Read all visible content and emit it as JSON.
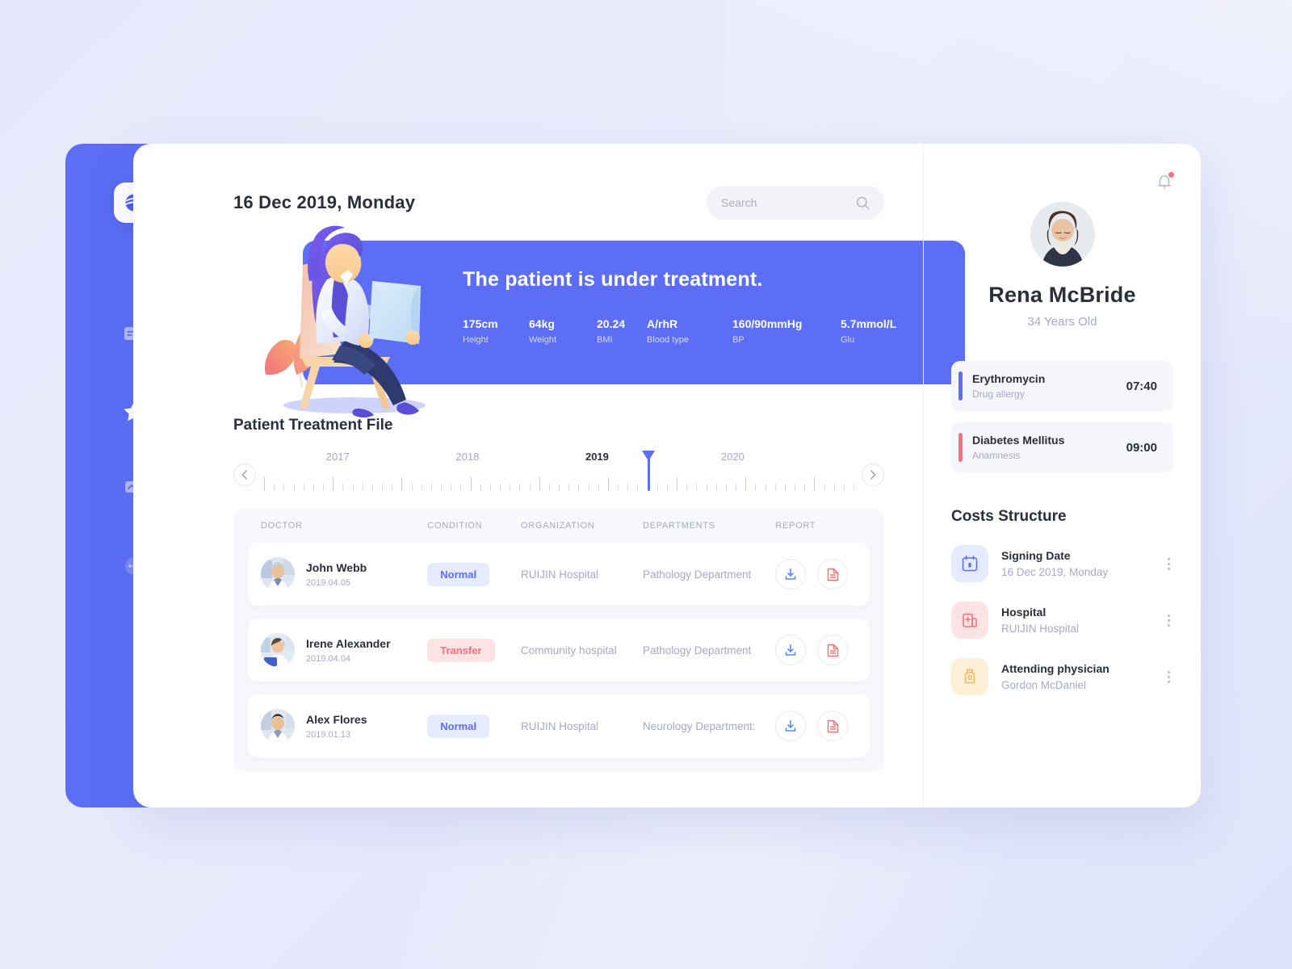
{
  "sidebar": {
    "logo_icon": "globe-swoosh-logo",
    "items": [
      {
        "icon": "id-card-icon",
        "name": "records",
        "active": false
      },
      {
        "icon": "star-icon",
        "name": "favorites",
        "active": true
      },
      {
        "icon": "chart-presentation-icon",
        "name": "analytics",
        "active": false
      },
      {
        "icon": "more-dots-icon",
        "name": "more",
        "active": false
      }
    ]
  },
  "header": {
    "date": "16 Dec 2019, Monday",
    "search": {
      "placeholder": "Search",
      "value": "",
      "icon": "search-icon"
    }
  },
  "hero": {
    "title": "The patient is under treatment.",
    "bg_color": "#5b6ef5",
    "illustration": "woman-reading-document-illustration",
    "stats": [
      {
        "value": "175cm",
        "label": "Height"
      },
      {
        "value": "64kg",
        "label": "Weight"
      },
      {
        "value": "20.24",
        "label": "BMI"
      },
      {
        "value": "A/rhR",
        "label": "Blood type"
      },
      {
        "value": "160/90mmHg",
        "label": "BP"
      },
      {
        "value": "5.7mmol/L",
        "label": "Glu"
      }
    ]
  },
  "treatment": {
    "section_title": "Patient Treatment File",
    "timeline": {
      "years": [
        "2017",
        "2018",
        "2019",
        "2020"
      ],
      "current_year": "2019",
      "marker_position_percent": 65,
      "prev_icon": "chevron-left-icon",
      "next_icon": "chevron-right-icon"
    },
    "columns": [
      "DOCTOR",
      "CONDITION",
      "ORGANIZATION",
      "DEPARTMENTS",
      "REPORT"
    ],
    "rows": [
      {
        "doctor": "John Webb",
        "date": "2019.04.05",
        "condition": "Normal",
        "condition_type": "normal",
        "organization": "RUIJIN Hospital",
        "department": "Pathology Department",
        "avatar": "doctor-male-senior-photo"
      },
      {
        "doctor": "Irene Alexander",
        "date": "2019.04.04",
        "condition": "Transfer",
        "condition_type": "transfer",
        "organization": "Community hospital",
        "department": "Pathology Department",
        "avatar": "doctor-female-photo"
      },
      {
        "doctor": "Alex Flores",
        "date": "2019.01.13",
        "condition": "Normal",
        "condition_type": "normal",
        "organization": "RUIJIN Hospital",
        "department": "Neurology Department:",
        "avatar": "doctor-male-young-photo"
      }
    ],
    "report_actions": [
      {
        "icon": "download-icon",
        "color": "#5b8cf5"
      },
      {
        "icon": "document-icon",
        "color": "#f2717a"
      }
    ]
  },
  "right_panel": {
    "notification": {
      "icon": "bell-icon",
      "has_unread": true,
      "dot_color": "#f2717a"
    },
    "patient": {
      "avatar": "patient-woman-photo",
      "name": "Rena McBride",
      "age": "34 Years Old"
    },
    "alerts": [
      {
        "title": "Erythromycin",
        "subtitle": "Drug allergy",
        "time": "07:40",
        "bar_color": "#5b6ef5"
      },
      {
        "title": "Diabetes Mellitus",
        "subtitle": "Anamnesis",
        "time": "09:00",
        "bar_color": "#f2717a"
      }
    ],
    "costs": {
      "title": "Costs Structure",
      "items": [
        {
          "label": "Signing Date",
          "value": "16 Dec 2019, Monday",
          "icon": "calendar-icon",
          "icon_color": "#5b6ef5",
          "tile_color": "#e6eafd"
        },
        {
          "label": "Hospital",
          "value": "RUIJIN Hospital",
          "icon": "hospital-icon",
          "icon_color": "#f2717a",
          "tile_color": "#fde3e4"
        },
        {
          "label": "Attending physician",
          "value": "Gordon McDaniel",
          "icon": "doctor-icon",
          "icon_color": "#f0b95a",
          "tile_color": "#fdf0d6"
        }
      ],
      "menu_icon": "kebab-menu-icon"
    }
  },
  "colors": {
    "accent": "#5b6ef5",
    "danger": "#f2717a",
    "warning": "#f0b95a",
    "text_dark": "#2b2f3a",
    "text_muted": "#a6aac2",
    "card_bg": "#ffffff",
    "panel_bg": "#f7f8fb"
  }
}
